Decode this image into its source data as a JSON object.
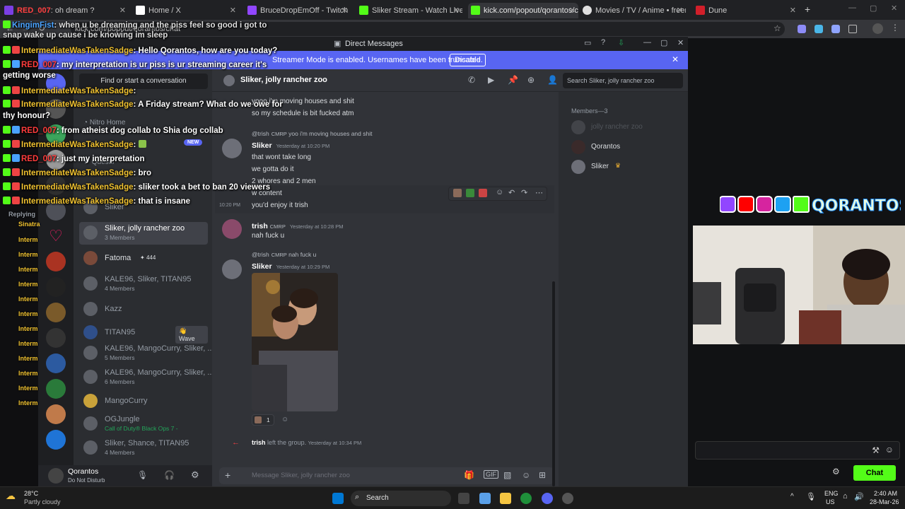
{
  "browser": {
    "tabs": [
      {
        "label": ": oh dream ?",
        "prefix": "RED_007",
        "color": "#7b3fe4"
      },
      {
        "label": "Home / X",
        "color": "#ffffff"
      },
      {
        "label": "BruceDropEmOff - Twitch",
        "color": "#9146ff"
      },
      {
        "label": "Sliker Stream - Watch Live on K",
        "color": "#53fc18"
      },
      {
        "label": "kick.com/popout/qorantos/cha",
        "color": "#53fc18"
      },
      {
        "label": "Movies / TV / Anime • freemed",
        "color": "#e0e0e0"
      },
      {
        "label": "Dune",
        "color": "#d11f2a"
      }
    ],
    "url": "kick.com/popout/qorantos/chat"
  },
  "overlay_chat": [
    {
      "user": "KingimFist",
      "text": ": when u be dreaming and the piss feel so good i got to"
    },
    {
      "user": "",
      "text": "snap wake up cause i be knowing im sleep"
    },
    {
      "user": "IntermediateWasTakenSadge",
      "text": ": Hello Qorantos, how are you today?"
    },
    {
      "user": "RED_007",
      "text": ": my interpretation is ur piss is ur streaming career it's"
    },
    {
      "user": "",
      "text": "getting worse"
    },
    {
      "user": "IntermediateWasTakenSadge",
      "text": ":"
    },
    {
      "user": "IntermediateWasTakenSadge",
      "text": ": A Friday stream? What do we owe for"
    },
    {
      "user": "",
      "text": "thy honour?"
    },
    {
      "user": "RED_007",
      "text": ": from atheist dog collab to Shia dog collab"
    },
    {
      "user": "IntermediateWasTakenSadge",
      "text": ":"
    },
    {
      "user": "RED_007",
      "text": ": just my interpretation"
    },
    {
      "user": "IntermediateWasTakenSadge",
      "text": ": bro"
    },
    {
      "user": "IntermediateWasTakenSadge",
      "text": ": sliker took a bet to ban 20 viewers"
    },
    {
      "user": "IntermediateWasTakenSadge",
      "text": ": that is insane"
    }
  ],
  "overlay_left_users": [
    "Replying",
    "Sinatra",
    "Interm",
    "Interm",
    "Interm",
    "Interm",
    "Interm",
    "Interm",
    "Interm",
    "Interm",
    "Interm",
    "Interm",
    "Interm",
    "Interm"
  ],
  "discord": {
    "window_title": "Direct Messages",
    "streamer_banner": "Streamer Mode is enabled. Usernames have been truncated.",
    "disable_label": "Disable",
    "find_placeholder": "Find or start a conversation",
    "nitro_label": "Nitro Home",
    "new_badge": "NEW",
    "quests_label": "Quests",
    "dm_list": [
      {
        "name": "Sliker",
        "sub": ""
      },
      {
        "name": "Sliker, jolly rancher zoo",
        "sub": "3 Members",
        "selected": true
      },
      {
        "name": "Fatoma",
        "sub": "",
        "badge": "444"
      },
      {
        "name": "KALE96, Sliker, TITAN95",
        "sub": "4 Members"
      },
      {
        "name": "Kazz",
        "sub": ""
      },
      {
        "name": "TITAN95",
        "sub": "",
        "action": "Wave"
      },
      {
        "name": "KALE96, MangoCurry, Sliker, ...",
        "sub": "5 Members"
      },
      {
        "name": "KALE96, MangoCurry, Sliker, ...",
        "sub": "6 Members"
      },
      {
        "name": "MangoCurry",
        "sub": ""
      },
      {
        "name": "OGJungle",
        "sub": "Call of Duty® Black Ops 7 -"
      },
      {
        "name": "Sliker, Shance, TITAN95",
        "sub": "4 Members"
      }
    ],
    "user_panel": {
      "name": "Qorantos",
      "status": "Do Not Disturb"
    },
    "chat_header": "Sliker, jolly rancher zoo",
    "search_placeholder": "Search Sliker, jolly rancher zoo",
    "messages": {
      "m0_line1": "yooo i'm moving houses and shit",
      "m0_line2": "so my schedule is bit fucked atm",
      "m1_reply_user": "@trish",
      "m1_reply_tag": "CMRP",
      "m1_reply_text": "yoo i'm moving houses and shit",
      "m1_author": "Sliker",
      "m1_time": "Yesterday at 10:20 PM",
      "m1_lines": [
        "that wont take long",
        "we gotta do it",
        "2 whores and 2 men",
        "w content",
        "you'd enjoy it trish"
      ],
      "m1_hover_time": "10:20 PM",
      "m2_author": "trish",
      "m2_tag": "CMRP",
      "m2_time": "Yesterday at 10:28 PM",
      "m2_text": "nah fuck u",
      "m3_reply_user": "@trish",
      "m3_reply_tag": "CMRP",
      "m3_reply_text": "nah fuck u",
      "m3_author": "Sliker",
      "m3_time": "Yesterday at 10:29 PM",
      "m3_reaction_count": "1",
      "sys_user": "trish",
      "sys_text": "left the group.",
      "sys_time": "Yesterday at 10:34 PM"
    },
    "composer_placeholder": "Message Sliker, jolly rancher zoo",
    "members_header": "Members—3",
    "members": [
      "jolly rancher zoo",
      "Qorantos",
      "Sliker"
    ]
  },
  "chat_send_label": "Chat",
  "taskbar": {
    "weather_temp": "28°C",
    "weather_desc": "Partly cloudy",
    "search_label": "Search",
    "lang1": "ENG",
    "lang2": "US",
    "time": "2:40 AM",
    "date": "28-Mar-26"
  },
  "colors": {
    "kick_green": "#53fc18",
    "discord_blurple": "#5865f2",
    "username_gold": "#f0c230"
  }
}
